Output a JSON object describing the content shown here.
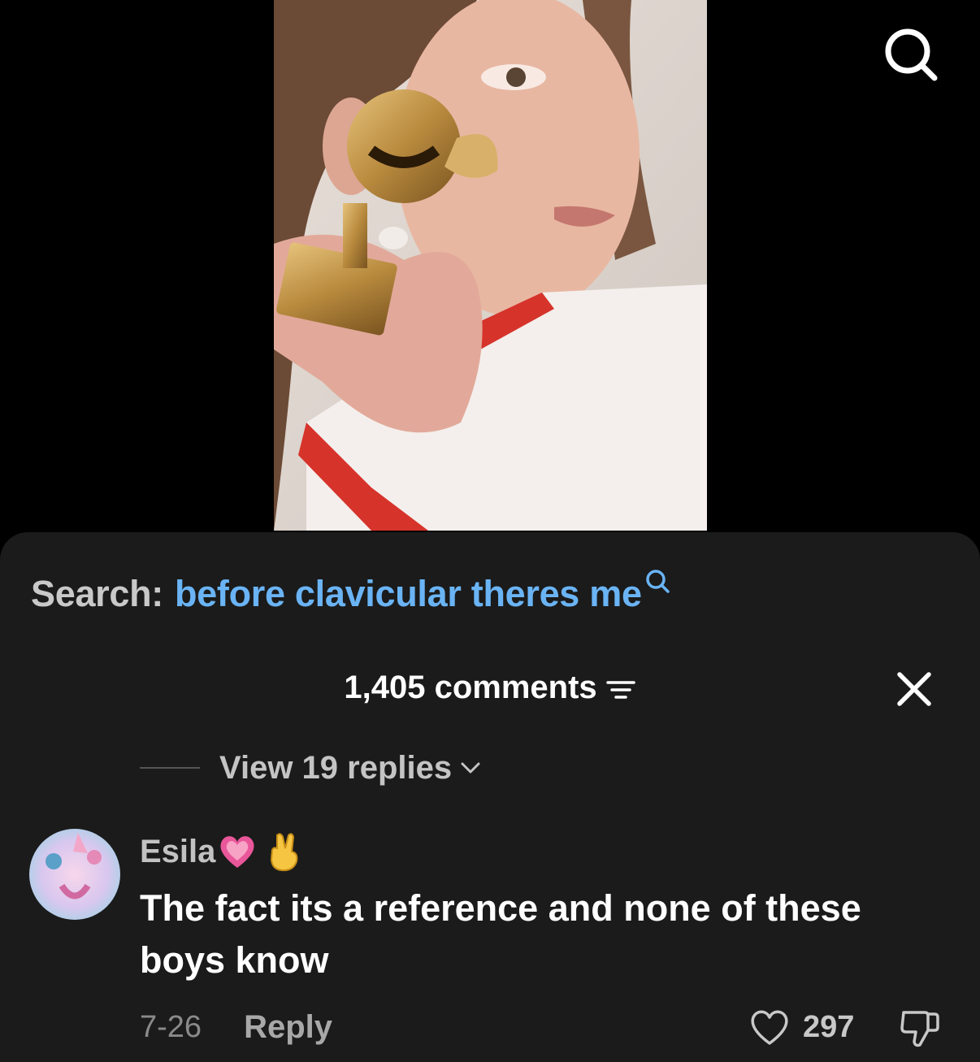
{
  "top_bar": {
    "search_icon": "search-icon"
  },
  "video": {
    "thumbnail_icon": "video-thumbnail"
  },
  "search": {
    "prefix": "Search:",
    "query": "before clavicular theres me",
    "query_icon": "search-icon"
  },
  "comments": {
    "count_label": "1,405 comments",
    "filter_icon": "filter-icon",
    "close_icon": "close-icon"
  },
  "replies": {
    "label": "View 19 replies",
    "chevron_icon": "chevron-down-icon"
  },
  "comment": {
    "username": "Esila",
    "username_emojis": [
      "pink-heart-icon",
      "crossed-fingers-hand-icon"
    ],
    "text": "The fact its a reference and none of these boys know",
    "date": "7-26",
    "reply_label": "Reply",
    "like_count": "297",
    "like_icon": "heart-outline-icon",
    "dislike_icon": "thumbs-down-icon"
  },
  "colors": {
    "sheet_background": "#1b1b1b",
    "search_query": "#6ab4f5",
    "primary_text": "#ffffff",
    "secondary_text": "#8a8a8a"
  }
}
